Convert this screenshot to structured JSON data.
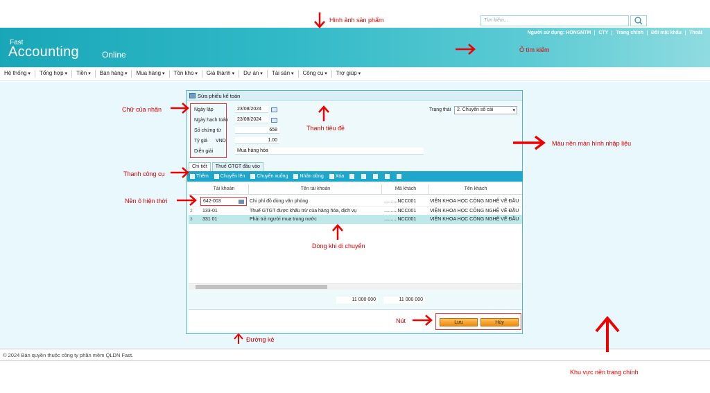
{
  "annotations": {
    "product_image": "Hình ảnh sản phẩm",
    "search_box": "Ô tìm kiếm",
    "label_text": "Chữ của nhãn",
    "title_bar": "Thanh tiêu đề",
    "input_bg_color": "Màu nền màn hình nhập liệu",
    "toolbar": "Thanh công cụ",
    "current_cell_bg": "Nền ô hiện thời",
    "moving_row": "Dòng khi di chuyển",
    "button": "Nút",
    "border_line": "Đường kẻ",
    "main_bg_area": "Khu vực nền trang chính"
  },
  "header": {
    "logo_small": "Fast",
    "logo_big": "Accounting",
    "logo_online": "Online",
    "top_links": [
      "Người sử dụng: HONGNTM",
      "CTY",
      "Trang chính",
      "Đổi mật khẩu",
      "Thoát"
    ],
    "search_placeholder": "Tìm kiếm...",
    "search_icon": "search-icon"
  },
  "nav": [
    "Hệ thống",
    "Tổng hợp",
    "Tiền",
    "Bán hàng",
    "Mua hàng",
    "Tồn kho",
    "Giá thành",
    "Dự án",
    "Tài sản",
    "Công cụ",
    "Trợ giúp"
  ],
  "dialog": {
    "title": "Sửa phiếu kế toán",
    "fields": {
      "ngay_lap_label": "Ngày lập",
      "ngay_lap": "23/08/2024",
      "ngay_hach_toan_label": "Ngày hạch toán",
      "ngay_hach_toan": "23/08/2024",
      "so_chung_tu_label": "Số chứng từ",
      "so_chung_tu": "658",
      "ty_gia_label": "Tỷ giá",
      "currency": "VND",
      "ty_gia": "1.00",
      "dien_giai_label": "Diễn giải",
      "dien_giai": "Mua hàng hóa",
      "trang_thai_label": "Trạng thái",
      "trang_thai": "2. Chuyển sổ cái"
    },
    "tabs": [
      "Chi tiết",
      "Thuế GTGT đầu vào"
    ],
    "toolbar": [
      "Thêm",
      "Chuyển lên",
      "Chuyển xuống",
      "Nhân dòng",
      "Xóa"
    ],
    "columns": [
      "Tài khoản",
      "Tên tài khoản",
      "Mã khách",
      "Tên khách"
    ],
    "rows": [
      {
        "n": "1",
        "account": "642-003",
        "account_name": "Chi phí đồ dùng văn phòng",
        "customer_code": "..........NCC001",
        "customer_name": "VIỆN KHOA HỌC CÔNG NGHỆ VỀ ĐẦU"
      },
      {
        "n": "2",
        "account": "133-01",
        "account_name": "Thuế GTGT được khấu trừ của hàng hóa, dịch vụ",
        "customer_code": "..........NCC001",
        "customer_name": "VIỆN KHOA HỌC CÔNG NGHỆ VỀ ĐẦU"
      },
      {
        "n": "3",
        "account": "331 01",
        "account_name": "Phải trả người mua trong nước",
        "customer_code": "..........NCC001",
        "customer_name": "VIỆN KHOA HỌC CÔNG NGHỆ VỀ ĐẦU"
      }
    ],
    "totals": [
      "11 000 000",
      "11 000 000"
    ],
    "save_label": "Lưu",
    "cancel_label": "Hủy"
  },
  "footer": "© 2024 Bản quyền thuộc công ty phần mềm QLDN Fast.",
  "colors": {
    "header": "#31b9c7",
    "toolbar": "#1fa6cb",
    "main_bg": "#e9f8fc",
    "moving_row": "#bfe8ea",
    "annotation": "#e00000",
    "button": "#f08a10"
  }
}
